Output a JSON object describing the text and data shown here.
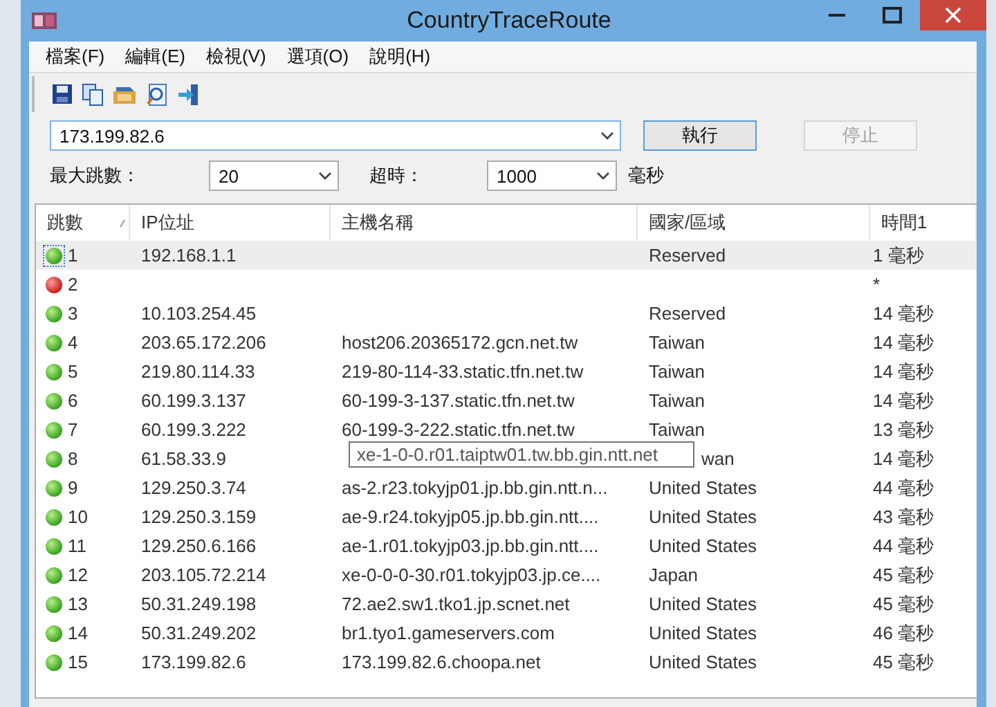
{
  "window": {
    "title": "CountryTraceRoute"
  },
  "menu": [
    "檔案(F)",
    "編輯(E)",
    "檢視(V)",
    "選項(O)",
    "說明(H)"
  ],
  "toolbar": [
    {
      "kind": "save"
    },
    {
      "kind": "copy"
    },
    {
      "kind": "open"
    },
    {
      "kind": "find"
    },
    {
      "kind": "exit"
    }
  ],
  "target": {
    "value": "173.199.82.6"
  },
  "buttons": [
    {
      "label": "執行",
      "disabled": false
    },
    {
      "label": "停止",
      "disabled": true
    }
  ],
  "options": {
    "max_hops_label": "最大跳數：",
    "max_hops": "20",
    "timeout_label": "超時：",
    "timeout": "1000",
    "unit": "毫秒"
  },
  "table": {
    "columns": [
      "跳數",
      "IP位址",
      "主機名稱",
      "國家/區域",
      "時間1"
    ],
    "rows": [
      {
        "hop": "1",
        "ip": "192.168.1.1",
        "country": "Reserved",
        "time": "1 毫秒",
        "reachable": true,
        "selected": true
      },
      {
        "hop": "2",
        "time": "*",
        "reachable": false,
        "selected": false
      },
      {
        "hop": "3",
        "ip": "10.103.254.45",
        "country": "Reserved",
        "time": "14 毫秒",
        "reachable": true,
        "selected": false
      },
      {
        "hop": "4",
        "ip": "203.65.172.206",
        "host": "host206.20365172.gcn.net.tw",
        "country": "Taiwan",
        "time": "14 毫秒",
        "reachable": true,
        "selected": false
      },
      {
        "hop": "5",
        "ip": "219.80.114.33",
        "host": "219-80-114-33.static.tfn.net.tw",
        "country": "Taiwan",
        "time": "14 毫秒",
        "reachable": true,
        "selected": false
      },
      {
        "hop": "6",
        "ip": "60.199.3.137",
        "host": "60-199-3-137.static.tfn.net.tw",
        "country": "Taiwan",
        "time": "14 毫秒",
        "reachable": true,
        "selected": false
      },
      {
        "hop": "7",
        "ip": "60.199.3.222",
        "host": "60-199-3-222.static.tfn.net.tw",
        "country": "Taiwan",
        "time": "13 毫秒",
        "reachable": true,
        "selected": false
      },
      {
        "hop": "8",
        "ip": "61.58.33.9",
        "tooltip": "xe-1-0-0.r01.taiptw01.tw.bb.gin.ntt.net",
        "country": "wan",
        "time": "14 毫秒",
        "reachable": true,
        "selected": false
      },
      {
        "hop": "9",
        "ip": "129.250.3.74",
        "host": "as-2.r23.tokyjp01.jp.bb.gin.ntt.n...",
        "country": "United States",
        "time": "44 毫秒",
        "reachable": true,
        "selected": false
      },
      {
        "hop": "10",
        "ip": "129.250.3.159",
        "host": "ae-9.r24.tokyjp05.jp.bb.gin.ntt....",
        "country": "United States",
        "time": "43 毫秒",
        "reachable": true,
        "selected": false
      },
      {
        "hop": "11",
        "ip": "129.250.6.166",
        "host": "ae-1.r01.tokyjp03.jp.bb.gin.ntt....",
        "country": "United States",
        "time": "44 毫秒",
        "reachable": true,
        "selected": false
      },
      {
        "hop": "12",
        "ip": "203.105.72.214",
        "host": "xe-0-0-0-30.r01.tokyjp03.jp.ce....",
        "country": "Japan",
        "time": "45 毫秒",
        "reachable": true,
        "selected": false
      },
      {
        "hop": "13",
        "ip": "50.31.249.198",
        "host": "72.ae2.sw1.tko1.jp.scnet.net",
        "country": "United States",
        "time": "45 毫秒",
        "reachable": true,
        "selected": false
      },
      {
        "hop": "14",
        "ip": "50.31.249.202",
        "host": "br1.tyo1.gameservers.com",
        "country": "United States",
        "time": "46 毫秒",
        "reachable": true,
        "selected": false
      },
      {
        "hop": "15",
        "ip": "173.199.82.6",
        "host": "173.199.82.6.choopa.net",
        "country": "United States",
        "time": "45 毫秒",
        "reachable": true,
        "selected": false
      }
    ]
  }
}
